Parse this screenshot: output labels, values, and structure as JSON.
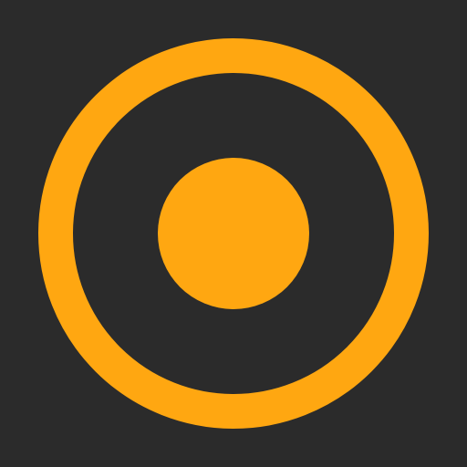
{
  "icon": {
    "name": "record-icon",
    "colors": {
      "background": "#2b2b2b",
      "accent": "#ffa711"
    }
  }
}
